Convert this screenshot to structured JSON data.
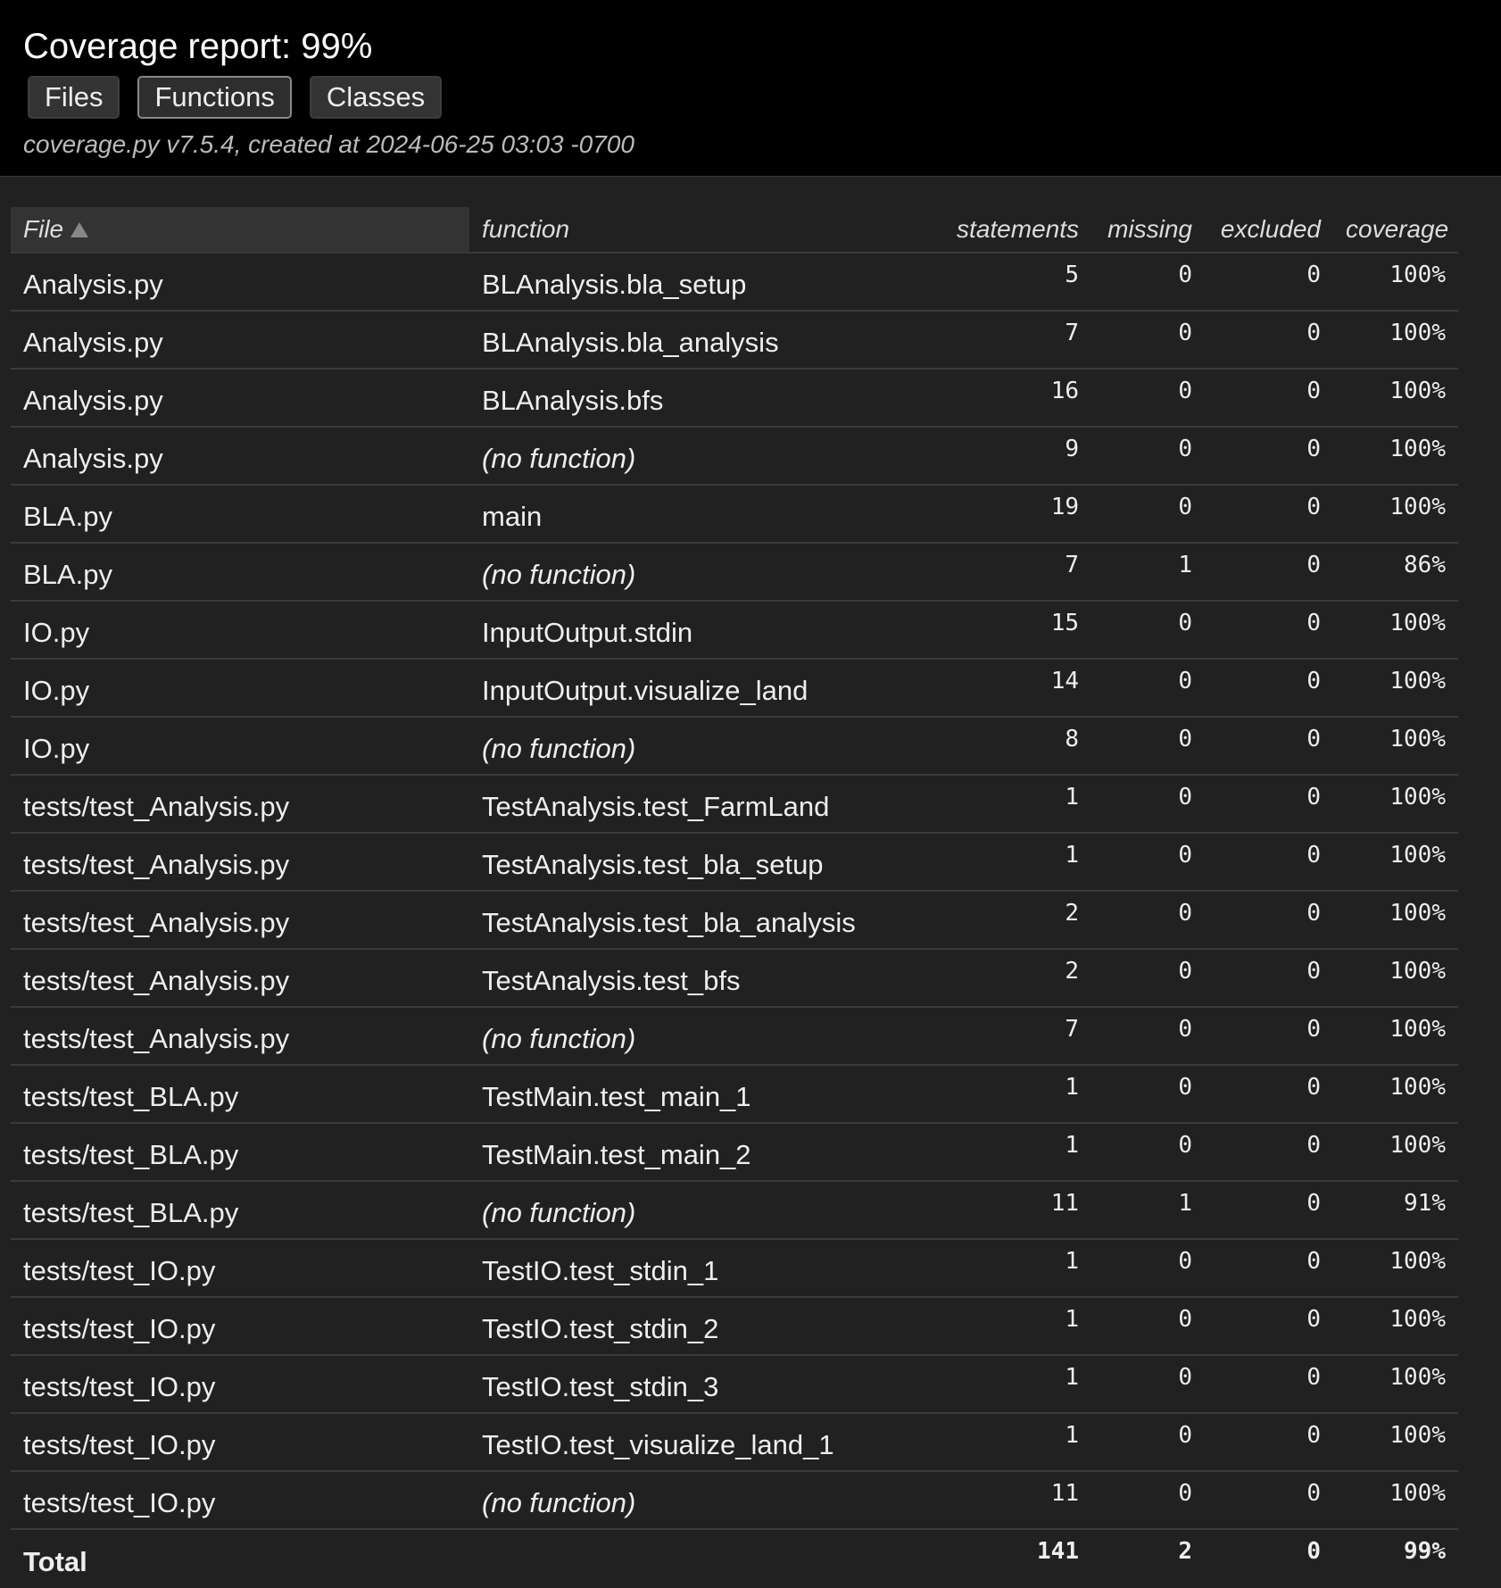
{
  "header": {
    "title": "Coverage report: 99%",
    "buttons": [
      {
        "label": "Files",
        "active": false
      },
      {
        "label": "Functions",
        "active": true
      },
      {
        "label": "Classes",
        "active": false
      }
    ],
    "meta": "coverage.py v7.5.4, created at 2024-06-25 03:03 -0700"
  },
  "table": {
    "columns": {
      "file": "File",
      "function": "function",
      "statements": "statements",
      "missing": "missing",
      "excluded": "excluded",
      "coverage": "coverage"
    },
    "sorted_column": "file",
    "sort_direction": "ascending",
    "rows": [
      {
        "file": "Analysis.py",
        "function": "BLAnalysis.bla_setup",
        "statements": "5",
        "missing": "0",
        "excluded": "0",
        "coverage": "100%"
      },
      {
        "file": "Analysis.py",
        "function": "BLAnalysis.bla_analysis",
        "statements": "7",
        "missing": "0",
        "excluded": "0",
        "coverage": "100%"
      },
      {
        "file": "Analysis.py",
        "function": "BLAnalysis.bfs",
        "statements": "16",
        "missing": "0",
        "excluded": "0",
        "coverage": "100%"
      },
      {
        "file": "Analysis.py",
        "function": "(no function)",
        "statements": "9",
        "missing": "0",
        "excluded": "0",
        "coverage": "100%"
      },
      {
        "file": "BLA.py",
        "function": "main",
        "statements": "19",
        "missing": "0",
        "excluded": "0",
        "coverage": "100%"
      },
      {
        "file": "BLA.py",
        "function": "(no function)",
        "statements": "7",
        "missing": "1",
        "excluded": "0",
        "coverage": "86%"
      },
      {
        "file": "IO.py",
        "function": "InputOutput.stdin",
        "statements": "15",
        "missing": "0",
        "excluded": "0",
        "coverage": "100%"
      },
      {
        "file": "IO.py",
        "function": "InputOutput.visualize_land",
        "statements": "14",
        "missing": "0",
        "excluded": "0",
        "coverage": "100%"
      },
      {
        "file": "IO.py",
        "function": "(no function)",
        "statements": "8",
        "missing": "0",
        "excluded": "0",
        "coverage": "100%"
      },
      {
        "file": "tests/test_Analysis.py",
        "function": "TestAnalysis.test_FarmLand",
        "statements": "1",
        "missing": "0",
        "excluded": "0",
        "coverage": "100%"
      },
      {
        "file": "tests/test_Analysis.py",
        "function": "TestAnalysis.test_bla_setup",
        "statements": "1",
        "missing": "0",
        "excluded": "0",
        "coverage": "100%"
      },
      {
        "file": "tests/test_Analysis.py",
        "function": "TestAnalysis.test_bla_analysis",
        "statements": "2",
        "missing": "0",
        "excluded": "0",
        "coverage": "100%"
      },
      {
        "file": "tests/test_Analysis.py",
        "function": "TestAnalysis.test_bfs",
        "statements": "2",
        "missing": "0",
        "excluded": "0",
        "coverage": "100%"
      },
      {
        "file": "tests/test_Analysis.py",
        "function": "(no function)",
        "statements": "7",
        "missing": "0",
        "excluded": "0",
        "coverage": "100%"
      },
      {
        "file": "tests/test_BLA.py",
        "function": "TestMain.test_main_1",
        "statements": "1",
        "missing": "0",
        "excluded": "0",
        "coverage": "100%"
      },
      {
        "file": "tests/test_BLA.py",
        "function": "TestMain.test_main_2",
        "statements": "1",
        "missing": "0",
        "excluded": "0",
        "coverage": "100%"
      },
      {
        "file": "tests/test_BLA.py",
        "function": "(no function)",
        "statements": "11",
        "missing": "1",
        "excluded": "0",
        "coverage": "91%"
      },
      {
        "file": "tests/test_IO.py",
        "function": "TestIO.test_stdin_1",
        "statements": "1",
        "missing": "0",
        "excluded": "0",
        "coverage": "100%"
      },
      {
        "file": "tests/test_IO.py",
        "function": "TestIO.test_stdin_2",
        "statements": "1",
        "missing": "0",
        "excluded": "0",
        "coverage": "100%"
      },
      {
        "file": "tests/test_IO.py",
        "function": "TestIO.test_stdin_3",
        "statements": "1",
        "missing": "0",
        "excluded": "0",
        "coverage": "100%"
      },
      {
        "file": "tests/test_IO.py",
        "function": "TestIO.test_visualize_land_1",
        "statements": "1",
        "missing": "0",
        "excluded": "0",
        "coverage": "100%"
      },
      {
        "file": "tests/test_IO.py",
        "function": "(no function)",
        "statements": "11",
        "missing": "0",
        "excluded": "0",
        "coverage": "100%"
      }
    ],
    "total": {
      "label": "Total",
      "statements": "141",
      "missing": "2",
      "excluded": "0",
      "coverage": "99%"
    }
  },
  "colors": {
    "header_bg": "#000000",
    "page_bg": "#212121",
    "row_border": "#3a3a3a",
    "sorted_header_bg": "#333333"
  },
  "icons": {
    "sort": "sort-ascending-icon"
  }
}
